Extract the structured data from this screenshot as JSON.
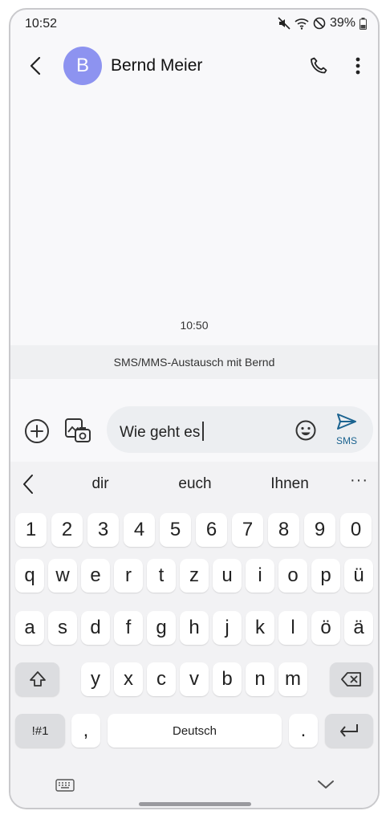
{
  "status_bar": {
    "time": "10:52",
    "battery": "39%",
    "icons": [
      "mute-icon",
      "wifi-icon",
      "do-not-disturb-icon",
      "battery-icon"
    ]
  },
  "header": {
    "avatar_letter": "B",
    "contact_name": "Bernd Meier",
    "avatar_color": "#8d93f0"
  },
  "conversation": {
    "timestamp": "10:50",
    "banner": "SMS/MMS-Austausch mit Bernd"
  },
  "composer": {
    "input_text": "Wie geht es",
    "send_label": "SMS",
    "accent": "#1b6390"
  },
  "keyboard": {
    "suggestions": [
      "dir",
      "euch",
      "Ihnen"
    ],
    "more_label": "···",
    "row_numbers": [
      "1",
      "2",
      "3",
      "4",
      "5",
      "6",
      "7",
      "8",
      "9",
      "0"
    ],
    "row1": [
      "q",
      "w",
      "e",
      "r",
      "t",
      "z",
      "u",
      "i",
      "o",
      "p",
      "ü"
    ],
    "row2": [
      "a",
      "s",
      "d",
      "f",
      "g",
      "h",
      "j",
      "k",
      "l",
      "ö",
      "ä"
    ],
    "row3": [
      "y",
      "x",
      "c",
      "v",
      "b",
      "n",
      "m"
    ],
    "symbols_label": "!#1",
    "comma_label": ",",
    "space_label": "Deutsch",
    "period_label": "."
  }
}
